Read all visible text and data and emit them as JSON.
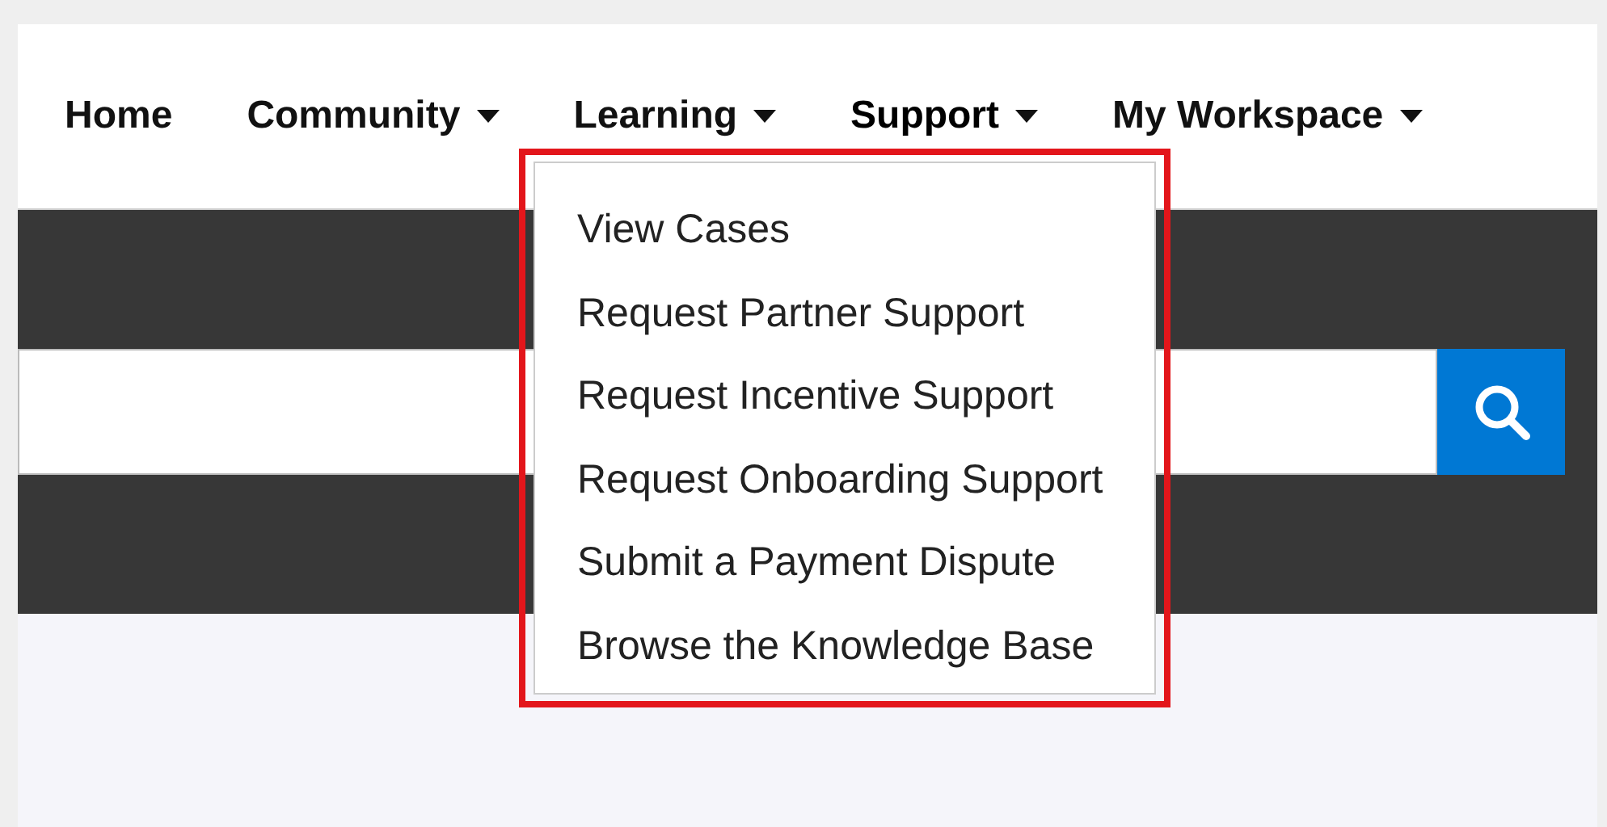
{
  "nav": {
    "items": [
      {
        "label": "Home",
        "has_menu": false,
        "expanded": false
      },
      {
        "label": "Community",
        "has_menu": true,
        "expanded": false
      },
      {
        "label": "Learning",
        "has_menu": true,
        "expanded": false
      },
      {
        "label": "Support",
        "has_menu": true,
        "expanded": true
      },
      {
        "label": "My Workspace",
        "has_menu": true,
        "expanded": false
      }
    ]
  },
  "dropdown": {
    "highlighted": true,
    "items": [
      {
        "label": "View Cases"
      },
      {
        "label": "Request Partner Support"
      },
      {
        "label": "Request Incentive Support"
      },
      {
        "label": "Request Onboarding Support"
      },
      {
        "label": "Submit a Payment Dispute"
      },
      {
        "label": "Browse the Knowledge Base"
      }
    ]
  }
}
